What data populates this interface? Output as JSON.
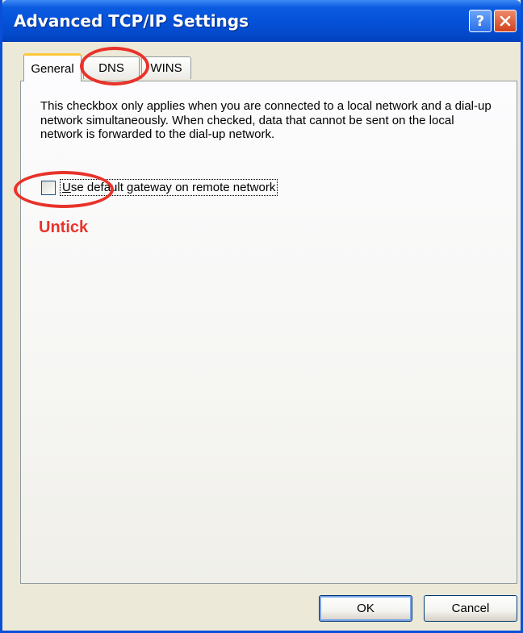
{
  "window": {
    "title": "Advanced TCP/IP Settings",
    "help_glyph": "?",
    "accent": "#0552d9"
  },
  "tabs": [
    {
      "label": "General",
      "active": true
    },
    {
      "label": "DNS",
      "active": false
    },
    {
      "label": "WINS",
      "active": false
    }
  ],
  "general": {
    "description": "This checkbox only applies when you are connected to a local network and a dial-up network simultaneously.  When checked, data that cannot be sent on the local network is forwarded to the dial-up network.",
    "checkbox": {
      "label_accel": "U",
      "label_rest": "se default gateway on remote network",
      "checked": false
    }
  },
  "annotation": {
    "text": "Untick",
    "color": "#e8332a"
  },
  "buttons": {
    "ok": "OK",
    "cancel": "Cancel"
  },
  "icons": {
    "help": "help-icon",
    "close": "close-icon"
  }
}
